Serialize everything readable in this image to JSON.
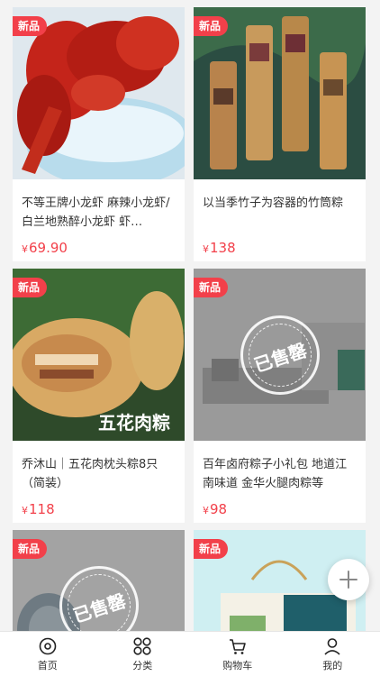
{
  "products": [
    {
      "badge": "新品",
      "title": "不等王牌小龙虾 麻辣小龙虾/白兰地熟醉小龙虾 虾…",
      "currency": "¥",
      "price": "69.90",
      "sold_out": false
    },
    {
      "badge": "新品",
      "title": "以当季竹子为容器的竹筒粽",
      "currency": "¥",
      "price": "138",
      "sold_out": false
    },
    {
      "badge": "新品",
      "title": "乔沐山｜五花肉枕头粽8只（简装）",
      "currency": "¥",
      "price": "118",
      "sold_out": false,
      "image_text": "五花肉粽"
    },
    {
      "badge": "新品",
      "title": "百年卤府粽子小礼包 地道江南味道 金华火腿肉粽等",
      "currency": "¥",
      "price": "98",
      "sold_out": true,
      "sold_label": "已售罄"
    },
    {
      "badge": "新品",
      "title": "",
      "currency": "",
      "price": "",
      "sold_out": true,
      "sold_label": "已售罄"
    },
    {
      "badge": "新品",
      "title": "",
      "currency": "",
      "price": "",
      "sold_out": false
    }
  ],
  "fab": {
    "icon": "plus-icon"
  },
  "tabbar": [
    {
      "label": "首页",
      "icon": "home-icon"
    },
    {
      "label": "分类",
      "icon": "category-icon"
    },
    {
      "label": "购物车",
      "icon": "cart-icon"
    },
    {
      "label": "我的",
      "icon": "user-icon"
    }
  ],
  "colors": {
    "accent": "#f2404a",
    "background": "#f3f3f3"
  }
}
